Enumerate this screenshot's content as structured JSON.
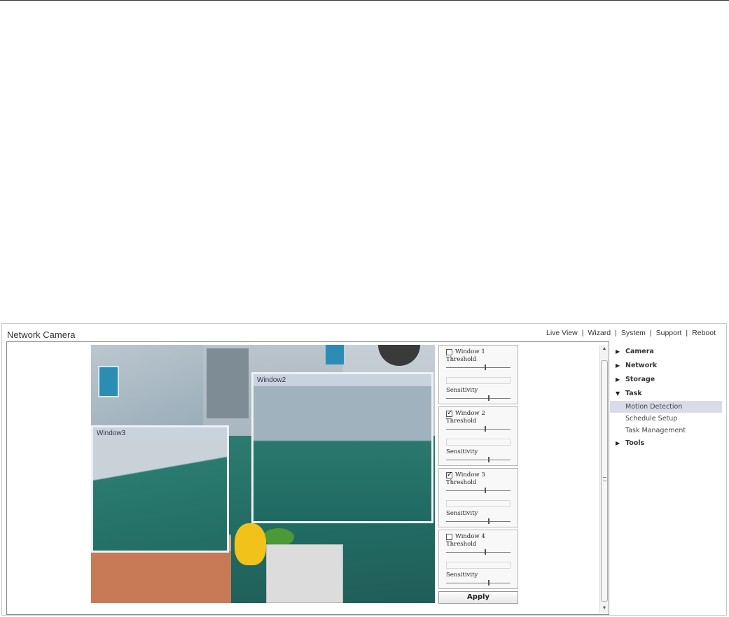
{
  "app": {
    "title": "Network Camera"
  },
  "topnav": {
    "links": [
      "Live View",
      "Wizard",
      "System",
      "Support",
      "Reboot"
    ]
  },
  "video": {
    "overlays": [
      {
        "title": "Window2"
      },
      {
        "title": "Window3"
      }
    ]
  },
  "motion_windows": [
    {
      "label": "Window 1",
      "checked": false,
      "threshold_label": "Threshold",
      "sensitivity_label": "Sensitivity",
      "threshold_level": 0.6,
      "sensitivity_level": 0.65
    },
    {
      "label": "Window 2",
      "checked": true,
      "threshold_label": "Threshold",
      "sensitivity_label": "Sensitivity",
      "threshold_level": 0.6,
      "sensitivity_level": 0.65
    },
    {
      "label": "Window 3",
      "checked": true,
      "threshold_label": "Threshold",
      "sensitivity_label": "Sensitivity",
      "threshold_level": 0.6,
      "sensitivity_level": 0.65
    },
    {
      "label": "Window 4",
      "checked": false,
      "threshold_label": "Threshold",
      "sensitivity_label": "Sensitivity",
      "threshold_level": 0.6,
      "sensitivity_level": 0.65
    }
  ],
  "apply_label": "Apply",
  "sidebar": {
    "items": [
      {
        "label": "Camera",
        "expanded": false
      },
      {
        "label": "Network",
        "expanded": false
      },
      {
        "label": "Storage",
        "expanded": false
      },
      {
        "label": "Task",
        "expanded": true,
        "children": [
          "Motion Detection",
          "Schedule Setup",
          "Task Management"
        ],
        "active_child": "Motion Detection"
      },
      {
        "label": "Tools",
        "expanded": false
      }
    ]
  },
  "icons": {
    "collapsed": "triangle-right-icon",
    "expanded": "triangle-down-icon"
  }
}
